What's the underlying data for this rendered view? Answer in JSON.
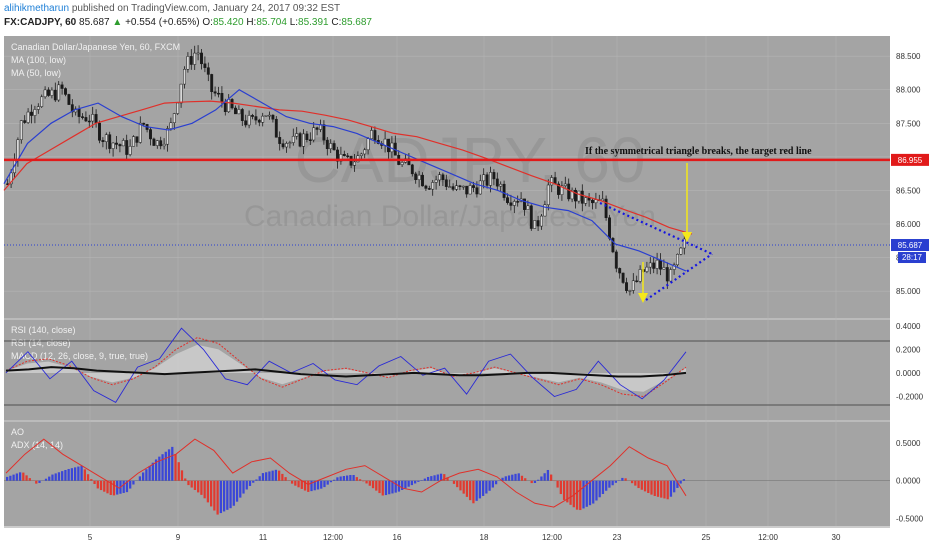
{
  "header": {
    "author": "alihikmetharun",
    "published": "published on TradingView.com, January 24, 2017 09:32 EST",
    "symbol": "FX:CADJPY, 60",
    "last": "85.687",
    "change": "+0.554 (+0.65%)",
    "open_label": "O:",
    "open": "85.420",
    "high_label": "H:",
    "high": "85.704",
    "low_label": "L:",
    "low": "85.391",
    "close_label": "C:",
    "close": "85.687"
  },
  "watermark": {
    "symbol": "CADJPY, 60",
    "name": "Canadian Dollar/Japanese Yen"
  },
  "colors": {
    "pane_bg": "#a4a4a4",
    "candle": "#1a1a1a",
    "ma100": "#e0302a",
    "ma50": "#2a3fd0",
    "target_line": "#e11a1a",
    "triangle": "#1515e0",
    "arrow": "#f5e81a",
    "rsi140": "#111111",
    "rsi14": "#2a2ad6",
    "macd_hist": "#cfcfcf",
    "macd_signal": "#e0302a",
    "ao_up": "#3a46d8",
    "ao_down": "#e03a30",
    "adx": "#e0302a"
  },
  "chart_data": [
    {
      "type": "candlestick",
      "pane": "price",
      "title": "Canadian Dollar/Japanese Yen, 60, FXCM",
      "legend": [
        "MA (100, low)",
        "MA (50, low)"
      ],
      "ylim": [
        84.6,
        88.8
      ],
      "yticks": [
        "88.500",
        "88.000",
        "87.500",
        "87.000",
        "86.500",
        "86.000",
        "85.500",
        "85.000"
      ],
      "target_level": 86.955,
      "target_label": "86.955",
      "last_label": "85.687",
      "countdown_label": "28:17",
      "annotation": "If the symmetrical triangle breaks, the target red line",
      "series_close": [
        86.6,
        87.5,
        87.8,
        87.9,
        88.0,
        87.6,
        87.6,
        87.3,
        87.2,
        87.1,
        87.5,
        87.2,
        87.4,
        88.3,
        88.6,
        88.0,
        87.8,
        87.6,
        87.5,
        87.7,
        87.3,
        87.2,
        87.3,
        87.4,
        87.1,
        86.9,
        87.0,
        87.4,
        87.2,
        86.9,
        86.8,
        86.6,
        86.7,
        86.5,
        86.5,
        86.6,
        86.7,
        86.4,
        86.4,
        85.9,
        86.6,
        86.5,
        86.4,
        86.3,
        86.3,
        85.4,
        85.0,
        85.3,
        85.4,
        85.2,
        85.69
      ],
      "ma100": [
        86.5,
        86.9,
        87.1,
        87.3,
        87.5,
        87.6,
        87.7,
        87.8,
        87.82,
        87.83,
        87.8,
        87.75,
        87.7,
        87.68,
        87.62,
        87.55,
        87.45,
        87.35,
        87.3,
        87.2,
        87.1,
        86.98,
        86.85,
        86.72,
        86.6,
        86.45,
        86.35,
        86.22,
        86.1,
        85.95,
        85.85
      ],
      "ma50": [
        86.6,
        87.2,
        87.5,
        87.7,
        87.8,
        87.6,
        87.45,
        87.4,
        87.5,
        87.7,
        88.0,
        87.8,
        87.6,
        87.5,
        87.45,
        87.35,
        87.2,
        87.05,
        86.9,
        86.75,
        86.6,
        86.5,
        86.35,
        86.25,
        86.2,
        86.05,
        85.7,
        85.6,
        85.45,
        85.3
      ]
    },
    {
      "type": "line",
      "pane": "oscillator",
      "legend": [
        "RSI (140, close)",
        "RSI (14, close)",
        "MACD (12, 26, close, 9, true, true)"
      ],
      "ylim": [
        -0.4,
        0.45
      ],
      "yticks": [
        "0.4000",
        "0.2000",
        "0.0000",
        "-0.2000"
      ],
      "rsi140": [
        0.02,
        0.03,
        0.05,
        0.04,
        0.02,
        0.01,
        0.0,
        -0.01,
        0.0,
        0.01,
        0.02,
        0.03,
        0.01,
        -0.01,
        -0.02,
        -0.03,
        -0.02,
        -0.01,
        0.0,
        -0.01,
        -0.02,
        -0.02,
        -0.01,
        0.0,
        0.0,
        -0.01,
        -0.02,
        -0.03,
        -0.03,
        -0.02,
        0.0
      ],
      "rsi14": [
        0.0,
        0.18,
        -0.05,
        0.1,
        -0.15,
        -0.25,
        0.05,
        0.12,
        0.38,
        0.2,
        -0.05,
        -0.1,
        0.1,
        0.0,
        0.08,
        -0.06,
        -0.1,
        0.06,
        0.14,
        -0.02,
        0.04,
        -0.18,
        0.1,
        0.16,
        -0.04,
        -0.2,
        -0.14,
        0.1,
        -0.1,
        -0.22,
        -0.06,
        0.18
      ],
      "macd_signal": [
        0.02,
        0.1,
        0.12,
        0.06,
        -0.04,
        -0.1,
        -0.05,
        0.05,
        0.2,
        0.3,
        0.25,
        0.1,
        -0.05,
        -0.12,
        -0.05,
        0.02,
        0.04,
        0.0,
        -0.04,
        0.02,
        0.05,
        -0.03,
        0.0,
        0.05,
        0.0,
        -0.05,
        -0.1,
        -0.05,
        -0.1,
        -0.18,
        -0.2,
        -0.08,
        0.05
      ]
    },
    {
      "type": "bar",
      "pane": "ao_adx",
      "legend": [
        "AO",
        "ADX (14, 14)"
      ],
      "ylim": [
        -0.6,
        0.75
      ],
      "yticks": [
        "0.5000",
        "0.0000",
        "-0.5000"
      ],
      "ao": [
        0.05,
        0.12,
        -0.05,
        0.08,
        0.15,
        0.2,
        -0.1,
        -0.2,
        -0.15,
        0.1,
        0.3,
        0.45,
        -0.05,
        -0.2,
        -0.45,
        -0.35,
        -0.1,
        0.1,
        0.15,
        -0.05,
        -0.15,
        -0.1,
        0.05,
        0.08,
        -0.05,
        -0.2,
        -0.15,
        -0.05,
        0.05,
        0.1,
        -0.1,
        -0.3,
        -0.15,
        0.05,
        0.1,
        -0.05,
        0.15,
        -0.25,
        -0.4,
        -0.3,
        -0.1,
        0.05,
        -0.1,
        -0.2,
        -0.25,
        0.02
      ],
      "adx": [
        0.1,
        0.35,
        0.55,
        0.35,
        0.2,
        0.05,
        -0.1,
        0.1,
        0.25,
        0.35,
        0.55,
        0.4,
        0.1,
        0.25,
        0.3,
        0.1,
        -0.05,
        0.05,
        0.15,
        0.2,
        0.05,
        -0.1,
        -0.15,
        0.0,
        0.1,
        0.15,
        0.05,
        -0.15,
        -0.3,
        -0.35,
        -0.2,
        0.0,
        0.2,
        0.45,
        0.3,
        0.2,
        -0.2
      ]
    }
  ],
  "x_axis": {
    "ticks": [
      "5",
      "9",
      "11",
      "12:00",
      "16",
      "18",
      "12:00",
      "23",
      "25",
      "12:00",
      "30"
    ]
  }
}
